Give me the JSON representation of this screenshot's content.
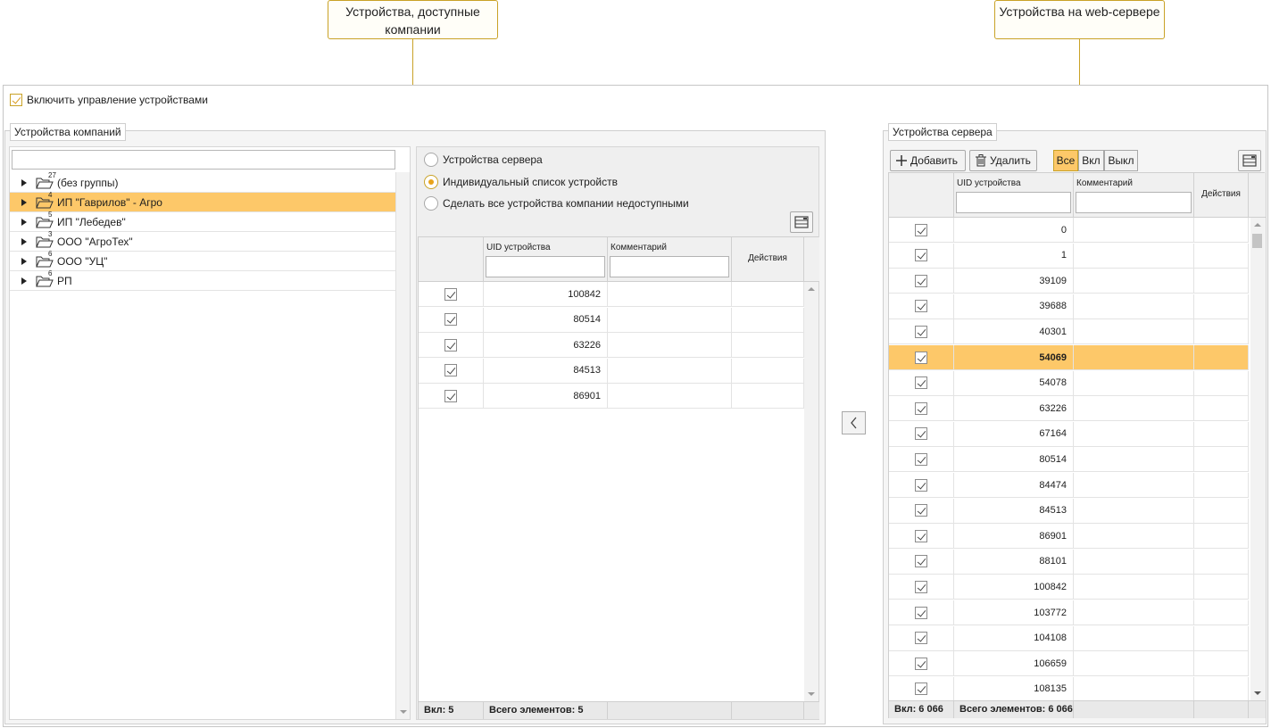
{
  "callouts": {
    "left": "Устройства, доступные компании",
    "right": "Устройства на web-сервере"
  },
  "enable_label": "Включить управление устройствами",
  "company_group": {
    "title": "Устройства компаний",
    "search_value": "",
    "tree": [
      {
        "count": "27",
        "label": "(без группы)",
        "selected": false
      },
      {
        "count": "4",
        "label": "ИП \"Гаврилов\" - Агро",
        "selected": true
      },
      {
        "count": "5",
        "label": "ИП \"Лебедев\"",
        "selected": false
      },
      {
        "count": "3",
        "label": "ООО \"АгроТех\"",
        "selected": false
      },
      {
        "count": "6",
        "label": "ООО \"УЦ\"",
        "selected": false
      },
      {
        "count": "6",
        "label": "РП",
        "selected": false
      }
    ]
  },
  "mode": {
    "options": [
      "Устройства сервера",
      "Индивидуальный список устройств",
      "Сделать все устройства компании недоступными"
    ],
    "selected_index": 1
  },
  "company_grid": {
    "col_uid": "UID устройства",
    "col_comment": "Комментарий",
    "col_actions": "Действия",
    "rows": [
      "100842",
      "80514",
      "63226",
      "84513",
      "86901"
    ],
    "footer_on": "Вкл: 5",
    "footer_total": "Всего элементов: 5"
  },
  "server_group": {
    "title": "Устройства сервера",
    "add_label": "Добавить",
    "delete_label": "Удалить",
    "filters": [
      "Все",
      "Вкл",
      "Выкл"
    ],
    "active_filter": "Все"
  },
  "server_grid": {
    "col_uid": "UID устройства",
    "col_comment": "Комментарий",
    "col_actions": "Действия",
    "rows": [
      "0",
      "1",
      "39109",
      "39688",
      "40301",
      "54069",
      "54078",
      "63226",
      "67164",
      "80514",
      "84474",
      "84513",
      "86901",
      "88101",
      "100842",
      "103772",
      "104108",
      "106659",
      "108135"
    ],
    "selected_row": "54069",
    "footer_on": "Вкл: 6 066",
    "footer_total": "Всего элементов: 6 066"
  },
  "colors": {
    "accent": "#c9a227",
    "selection": "#fdc869"
  }
}
